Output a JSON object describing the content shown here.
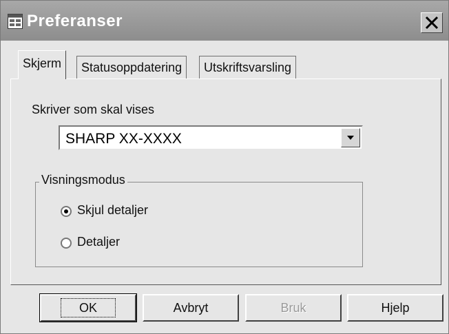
{
  "window": {
    "title": "Preferanser"
  },
  "tabs": [
    {
      "label": "Skjerm",
      "active": true
    },
    {
      "label": "Statusoppdatering",
      "active": false
    },
    {
      "label": "Utskriftsvarsling",
      "active": false
    }
  ],
  "display": {
    "printer_label": "Skriver som skal vises",
    "printer_value": "SHARP XX-XXXX",
    "mode_group": {
      "legend": "Visningsmodus",
      "options": [
        {
          "label": "Skjul detaljer",
          "selected": true
        },
        {
          "label": "Detaljer",
          "selected": false
        }
      ]
    }
  },
  "buttons": {
    "ok": "OK",
    "cancel": "Avbryt",
    "apply": "Bruk",
    "help": "Hjelp"
  },
  "icons": {
    "app": "grid-window-icon",
    "close": "close-icon",
    "dropdown": "chevron-down-icon"
  }
}
